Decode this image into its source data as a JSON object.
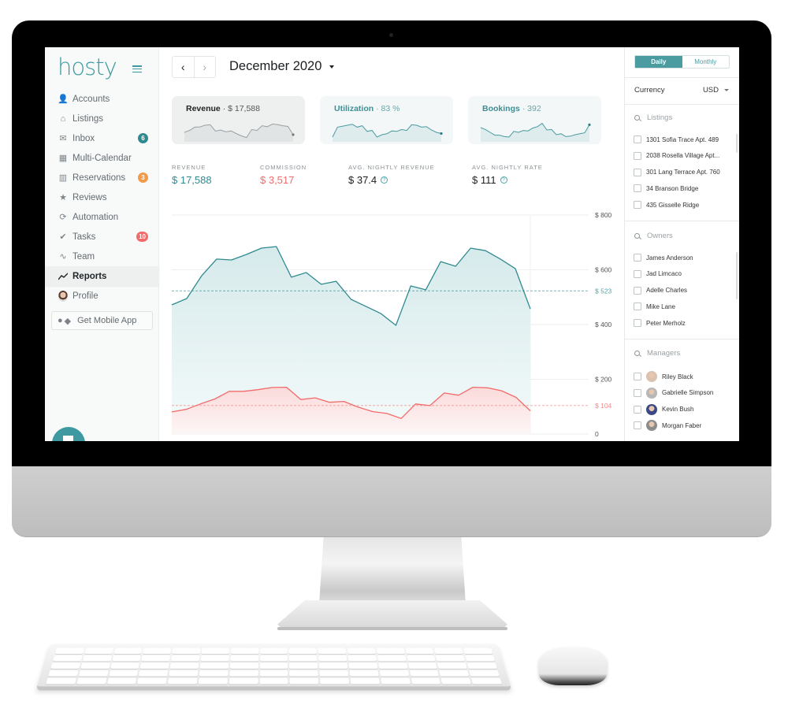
{
  "app": {
    "logo": "hosty"
  },
  "sidebar": {
    "items": [
      {
        "label": "Accounts",
        "icon": "user-plus-icon",
        "glyph": "👤"
      },
      {
        "label": "Listings",
        "icon": "home-icon",
        "glyph": "⌂"
      },
      {
        "label": "Inbox",
        "icon": "envelope-icon",
        "glyph": "✉",
        "badge": "6",
        "badge_color": "#2f8a90"
      },
      {
        "label": "Multi-Calendar",
        "icon": "calendar-icon",
        "glyph": "▦"
      },
      {
        "label": "Reservations",
        "icon": "suitcase-icon",
        "glyph": "▥",
        "badge": "3",
        "badge_color": "#f2994a"
      },
      {
        "label": "Reviews",
        "icon": "star-icon",
        "glyph": "★"
      },
      {
        "label": "Automation",
        "icon": "sync-icon",
        "glyph": "⟳"
      },
      {
        "label": "Tasks",
        "icon": "check-circle-icon",
        "glyph": "✔",
        "badge": "10",
        "badge_color": "#f26b6b"
      },
      {
        "label": "Team",
        "icon": "pulse-icon",
        "glyph": "∿"
      },
      {
        "label": "Reports",
        "icon": "trend-line-icon",
        "glyph": "↗",
        "active": true
      },
      {
        "label": "Profile",
        "icon": "avatar-icon",
        "glyph": ""
      }
    ],
    "mobile_app_label": "Get Mobile App"
  },
  "header": {
    "prev_label": "‹",
    "next_label": "›",
    "month": "December 2020"
  },
  "cards": {
    "revenue": {
      "title": "Revenue",
      "value": "· $ 17,588"
    },
    "utilization": {
      "title": "Utilization",
      "value": "· 83 %"
    },
    "bookings": {
      "title": "Bookings",
      "value": "· 392"
    }
  },
  "kpis": [
    {
      "label": "Revenue",
      "value": "$ 17,588",
      "color": "#2f8a90"
    },
    {
      "label": "Commission",
      "value": "$ 3,517",
      "color": "#f26b6b"
    },
    {
      "label": "Avg. Nightly Revenue",
      "value": "$ 37.4",
      "color": "#1c1f21",
      "help": true
    },
    {
      "label": "Avg. Nightly Rate",
      "value": "$ 111",
      "color": "#1c1f21",
      "help": true
    }
  ],
  "colors": {
    "accent": "#3e9aa0",
    "revenue_line": "#2f8a90",
    "commission_line": "#f26b6b"
  },
  "chart_data": {
    "type": "area",
    "title": "",
    "xlabel": "",
    "ylabel": "",
    "ylim": [
      0,
      800
    ],
    "yticks": [
      "$ 800",
      "$ 600",
      "$ 400",
      "$ 200",
      "0"
    ],
    "ytick_values": [
      800,
      600,
      400,
      200,
      0
    ],
    "grid": true,
    "x": [
      1,
      2,
      3,
      4,
      5,
      6,
      7,
      8,
      9,
      10,
      11,
      12,
      13,
      14,
      15,
      16,
      17,
      18,
      19,
      20,
      21,
      22,
      23,
      24,
      25
    ],
    "series": [
      {
        "name": "Revenue",
        "color": "#2f8a90",
        "values": [
          472,
          495,
          578,
          639,
          636,
          656,
          679,
          685,
          573,
          590,
          547,
          558,
          492,
          466,
          440,
          397,
          541,
          527,
          630,
          613,
          679,
          670,
          639,
          604,
          457
        ],
        "average": 523,
        "average_label": "$ 523"
      },
      {
        "name": "Commission",
        "color": "#f26b6b",
        "values": [
          81,
          90,
          110,
          128,
          156,
          156,
          162,
          170,
          171,
          126,
          132,
          116,
          119,
          98,
          82,
          75,
          57,
          110,
          104,
          150,
          142,
          171,
          169,
          158,
          134,
          85
        ],
        "average": 104,
        "average_label": "$ 104"
      }
    ]
  },
  "sparklines": {
    "revenue": [
      40,
      48,
      62,
      63,
      70,
      72,
      45,
      50,
      42,
      46,
      35,
      25,
      18,
      52,
      48,
      68,
      64,
      75,
      73,
      68,
      65,
      30
    ],
    "utilization": [
      20,
      62,
      66,
      70,
      74,
      62,
      68,
      44,
      48,
      20,
      30,
      34,
      46,
      44,
      52,
      48,
      72,
      70,
      62,
      64,
      50,
      40,
      35
    ],
    "bookings": [
      60,
      52,
      40,
      28,
      28,
      22,
      20,
      44,
      40,
      48,
      46,
      58,
      64,
      78,
      50,
      52,
      30,
      34,
      22,
      24,
      30,
      34,
      38,
      72
    ]
  },
  "right_panel": {
    "toggle": {
      "daily": "Daily",
      "monthly": "Monthly",
      "selected": "Daily"
    },
    "currency_label": "Currency",
    "currency_value": "USD",
    "listings": {
      "placeholder": "Listings",
      "items": [
        "1301 Sofia Trace Apt. 489",
        "2038 Rosella Village Apt...",
        "301 Lang Terrace Apt. 760",
        "34 Branson Bridge",
        "435 Gisselle Ridge"
      ]
    },
    "owners": {
      "placeholder": "Owners",
      "items": [
        "James Anderson",
        "Jad Limcaco",
        "Adelle Charles",
        "Mike Lane",
        "Peter Merholz"
      ]
    },
    "managers": {
      "placeholder": "Managers",
      "items": [
        "Riley Black",
        "Gabrielle Simpson",
        "Kevin Bush",
        "Morgan Faber"
      ]
    }
  }
}
